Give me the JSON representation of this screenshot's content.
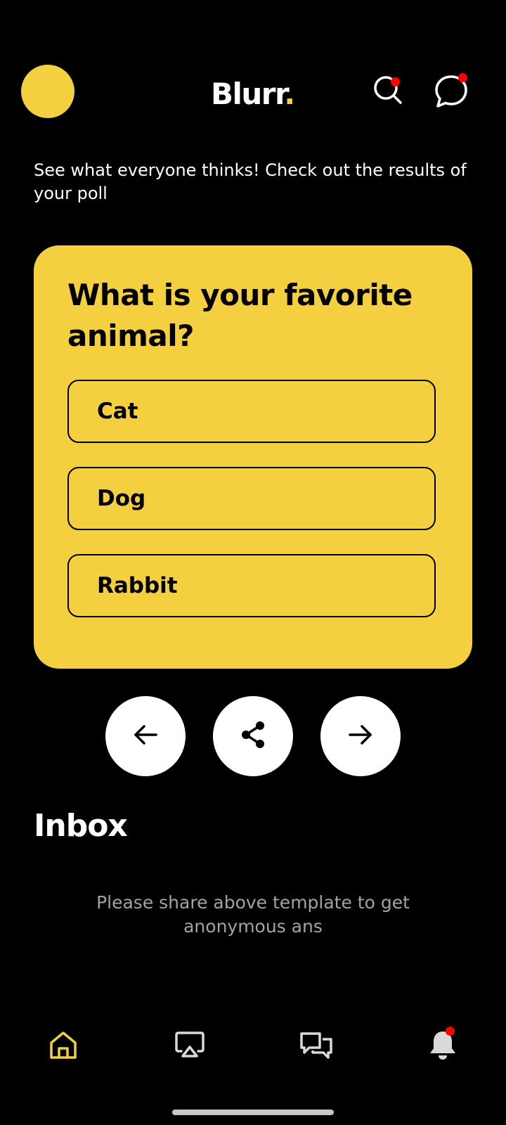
{
  "app": {
    "logo_text": "Blurr",
    "logo_dot": "."
  },
  "header": {
    "avatar_color": "#F4CF40",
    "search_icon": "search-icon",
    "chat_icon": "chat-bubble-icon",
    "notification_dot_color": "#FF0000"
  },
  "subtitle": "See what everyone thinks! Check out the results of your poll",
  "poll": {
    "question": "What is your favorite animal?",
    "card_color": "#F4CF40",
    "options": [
      {
        "label": "Cat"
      },
      {
        "label": "Dog"
      },
      {
        "label": "Rabbit"
      }
    ]
  },
  "actions": {
    "previous_icon": "arrow-left-icon",
    "share_icon": "share-icon",
    "next_icon": "arrow-right-icon"
  },
  "inbox": {
    "title": "Inbox",
    "empty_message": "Please share above template to get anonymous ans"
  },
  "bottom_nav": {
    "active_color": "#F4CF40",
    "items": [
      {
        "icon": "home-icon",
        "active": true
      },
      {
        "icon": "airplay-icon",
        "active": false
      },
      {
        "icon": "chat-bubbles-icon",
        "active": false
      },
      {
        "icon": "bell-icon",
        "active": false,
        "has_notification": true
      }
    ]
  }
}
